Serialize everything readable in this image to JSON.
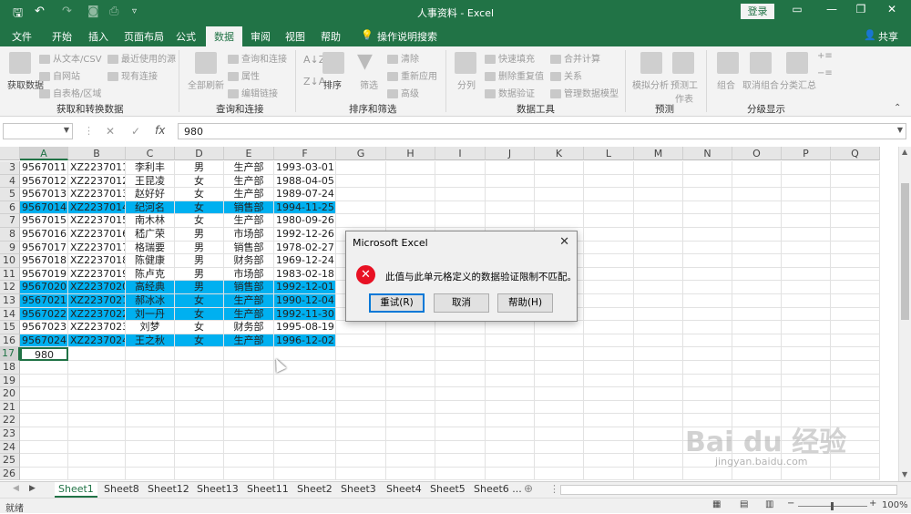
{
  "window": {
    "title": "人事资料 - Excel",
    "login": "登录"
  },
  "tabs": [
    "文件",
    "开始",
    "插入",
    "页面布局",
    "公式",
    "数据",
    "审阅",
    "视图",
    "帮助",
    "操作说明搜索"
  ],
  "active_tab": "数据",
  "share": "共享",
  "ribbon": {
    "get": {
      "big": "获取数据",
      "items": [
        "从文本/CSV",
        "最近使用的源",
        "自网站",
        "现有连接",
        "自表格/区域"
      ],
      "group": "获取和转换数据"
    },
    "queries": {
      "big": "全部刷新",
      "items": [
        "查询和连接",
        "属性",
        "编辑链接"
      ],
      "group": "查询和连接"
    },
    "sort": {
      "items": [
        "排序",
        "筛选",
        "清除",
        "重新应用",
        "高级"
      ],
      "group": "排序和筛选"
    },
    "tools": {
      "big": "分列",
      "items": [
        "快速填充",
        "合并计算",
        "删除重复值",
        "关系",
        "数据验证",
        "管理数据模型"
      ],
      "group": "数据工具"
    },
    "forecast": {
      "items": [
        "模拟分析",
        "预测工作表"
      ],
      "group": "预测"
    },
    "outline": {
      "items": [
        "组合",
        "取消组合",
        "分类汇总"
      ],
      "group": "分级显示"
    }
  },
  "formula_bar": {
    "fx": "fx",
    "value": "980"
  },
  "columns": [
    "A",
    "B",
    "C",
    "D",
    "E",
    "F",
    "G",
    "H",
    "I",
    "J",
    "K",
    "L",
    "M",
    "N",
    "O",
    "P",
    "Q"
  ],
  "rows": [
    {
      "n": "3",
      "a": "9567011",
      "b": "XZ2237011",
      "c": "李利丰",
      "d": "男",
      "e": "生产部",
      "f": "1993-03-01",
      "hl": false
    },
    {
      "n": "4",
      "a": "9567012",
      "b": "XZ2237012",
      "c": "王昆凌",
      "d": "女",
      "e": "生产部",
      "f": "1988-04-05",
      "hl": false
    },
    {
      "n": "5",
      "a": "9567013",
      "b": "XZ2237013",
      "c": "赵好好",
      "d": "女",
      "e": "生产部",
      "f": "1989-07-24",
      "hl": false
    },
    {
      "n": "6",
      "a": "9567014",
      "b": "XZ2237014",
      "c": "纪河名",
      "d": "女",
      "e": "销售部",
      "f": "1994-11-25",
      "hl": true
    },
    {
      "n": "7",
      "a": "9567015",
      "b": "XZ2237015",
      "c": "南木林",
      "d": "女",
      "e": "生产部",
      "f": "1980-09-26",
      "hl": false
    },
    {
      "n": "8",
      "a": "9567016",
      "b": "XZ2237016",
      "c": "嵇广荣",
      "d": "男",
      "e": "市场部",
      "f": "1992-12-26",
      "hl": false
    },
    {
      "n": "9",
      "a": "9567017",
      "b": "XZ2237017",
      "c": "格瑞要",
      "d": "男",
      "e": "销售部",
      "f": "1978-02-27",
      "hl": false
    },
    {
      "n": "10",
      "a": "9567018",
      "b": "XZ2237018",
      "c": "陈健康",
      "d": "男",
      "e": "财务部",
      "f": "1969-12-24",
      "hl": false
    },
    {
      "n": "11",
      "a": "9567019",
      "b": "XZ2237019",
      "c": "陈卢克",
      "d": "男",
      "e": "市场部",
      "f": "1983-02-18",
      "hl": false
    },
    {
      "n": "12",
      "a": "9567020",
      "b": "XZ2237020",
      "c": "高经典",
      "d": "男",
      "e": "销售部",
      "f": "1992-12-01",
      "hl": true
    },
    {
      "n": "13",
      "a": "9567021",
      "b": "XZ2237021",
      "c": "郝冰冰",
      "d": "女",
      "e": "生产部",
      "f": "1990-12-04",
      "hl": true
    },
    {
      "n": "14",
      "a": "9567022",
      "b": "XZ2237022",
      "c": "刘一丹",
      "d": "女",
      "e": "生产部",
      "f": "1992-11-30",
      "hl": true
    },
    {
      "n": "15",
      "a": "9567023",
      "b": "XZ2237023",
      "c": "刘梦",
      "d": "女",
      "e": "财务部",
      "f": "1995-08-19",
      "hl": false
    },
    {
      "n": "16",
      "a": "9567024",
      "b": "XZ2237024",
      "c": "王之秋",
      "d": "女",
      "e": "生产部",
      "f": "1996-12-02",
      "hl": true
    },
    {
      "n": "17",
      "a": "980",
      "b": "",
      "c": "",
      "d": "",
      "e": "",
      "f": "",
      "hl": false
    },
    {
      "n": "18"
    },
    {
      "n": "19"
    },
    {
      "n": "20"
    },
    {
      "n": "21"
    },
    {
      "n": "22"
    },
    {
      "n": "23"
    },
    {
      "n": "24"
    },
    {
      "n": "25"
    },
    {
      "n": "26"
    }
  ],
  "sheets": [
    "Sheet1",
    "Sheet8",
    "Sheet12",
    "Sheet13",
    "Sheet11",
    "Sheet2",
    "Sheet3",
    "Sheet4",
    "Sheet5",
    "Sheet6 ..."
  ],
  "active_sheet": "Sheet1",
  "status": {
    "mode": "就绪",
    "zoom": "100%"
  },
  "dialog": {
    "title": "Microsoft Excel",
    "message": "此值与此单元格定义的数据验证限制不匹配。",
    "buttons": [
      "重试(R)",
      "取消",
      "帮助(H)"
    ]
  },
  "watermark": {
    "text": "Bai du 经验",
    "sub": "jingyan.baidu.com"
  },
  "colors": {
    "excel_green": "#217346",
    "highlight": "#00b0f0",
    "error_red": "#e81123"
  }
}
